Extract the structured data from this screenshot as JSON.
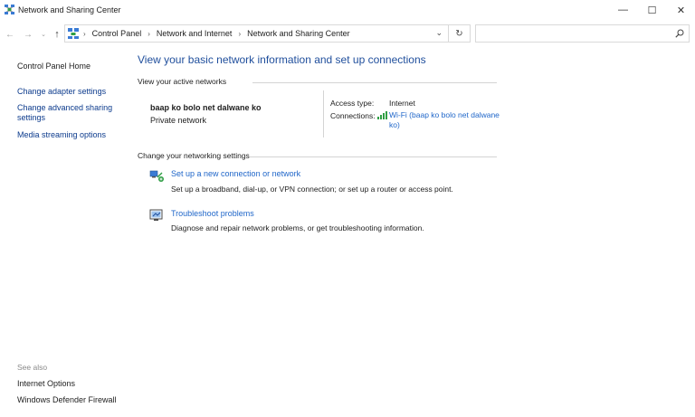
{
  "window": {
    "title": "Network and Sharing Center",
    "minimize": "—",
    "maximize": "☐",
    "close": "✕"
  },
  "address": {
    "crumbs": [
      "Control Panel",
      "Network and Internet",
      "Network and Sharing Center"
    ],
    "dropdown": "⌄",
    "refresh": "↻",
    "search_placeholder": ""
  },
  "nav": {
    "back": "←",
    "forward": "→",
    "recent": "⌄",
    "up": "↑"
  },
  "sidebar": {
    "home": "Control Panel Home",
    "links": [
      "Change adapter settings",
      "Change advanced sharing settings",
      "Media streaming options"
    ],
    "see_also_heading": "See also",
    "see_also": [
      "Internet Options",
      "Windows Defender Firewall"
    ]
  },
  "main": {
    "title": "View your basic network information and set up connections",
    "active_networks_heading": "View your active networks",
    "network_name": "baap ko bolo net dalwane ko",
    "network_type": "Private network",
    "access_type_label": "Access type:",
    "access_type_value": "Internet",
    "connections_label": "Connections:",
    "connection_link": "Wi-Fi (baap ko bolo net dalwane ko)",
    "change_settings_heading": "Change your networking settings",
    "tasks": [
      {
        "icon": "new-connection-icon",
        "link": "Set up a new connection or network",
        "desc": "Set up a broadband, dial-up, or VPN connection; or set up a router or access point."
      },
      {
        "icon": "troubleshoot-icon",
        "link": "Troubleshoot problems",
        "desc": "Diagnose and repair network problems, or get troubleshooting information."
      }
    ]
  },
  "colors": {
    "link": "#1f66c9",
    "title": "#1f4e9c",
    "muted": "#8a8a8a"
  }
}
